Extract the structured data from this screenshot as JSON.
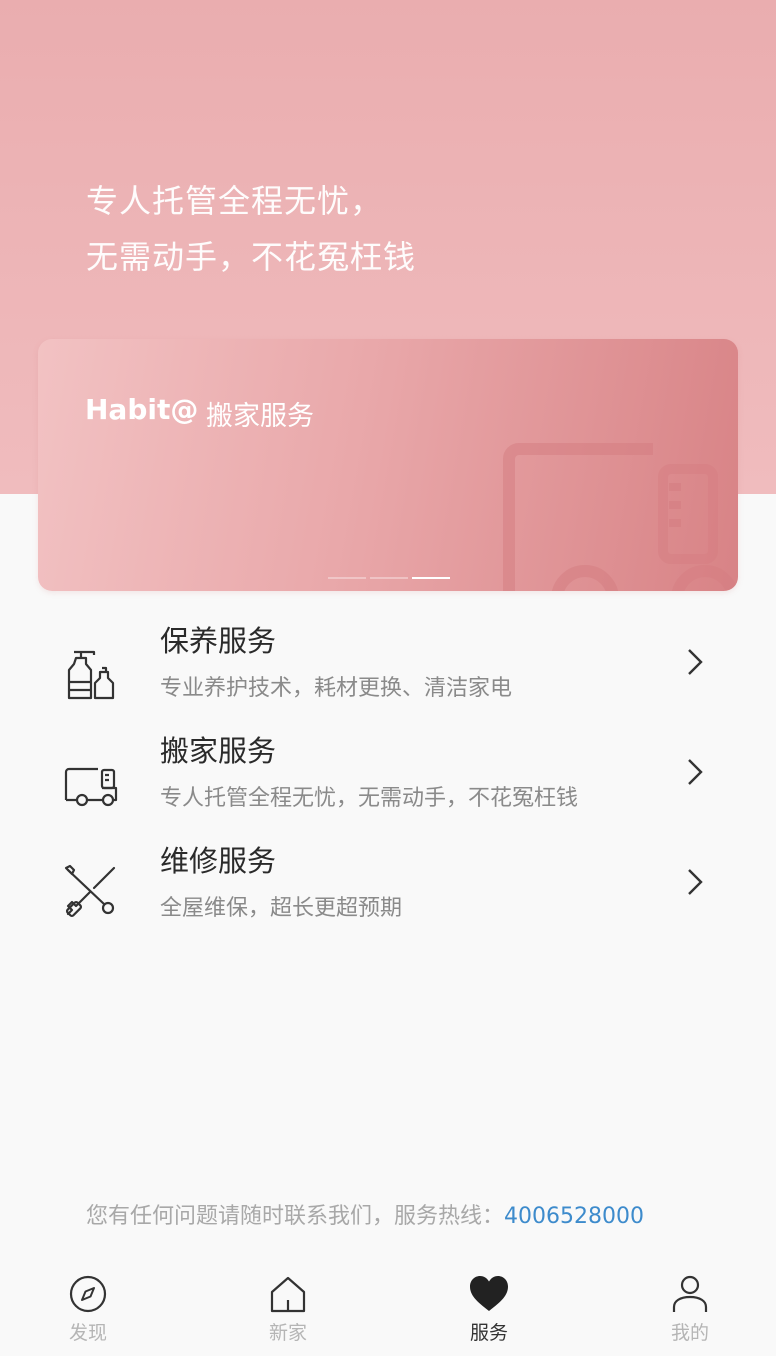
{
  "hero": {
    "line1": "专人托管全程无忧，",
    "line2": "无需动手，不花冤枉钱"
  },
  "banner": {
    "logo": "Habit@",
    "title": "搬家服务",
    "active_dot": 3,
    "dot_count": 3
  },
  "services": [
    {
      "title": "保养服务",
      "desc": "专业养护技术，耗材更换、清洁家电",
      "icon": "bottles-icon"
    },
    {
      "title": "搬家服务",
      "desc": "专人托管全程无忧，无需动手，不花冤枉钱",
      "icon": "truck-icon"
    },
    {
      "title": "维修服务",
      "desc": "全屋维保，超长更超预期",
      "icon": "tools-icon"
    }
  ],
  "hotline": {
    "text": "您有任何问题请随时联系我们，服务热线：",
    "number": "4006528000"
  },
  "tabs": [
    {
      "label": "发现",
      "icon": "compass-icon"
    },
    {
      "label": "新家",
      "icon": "home-icon"
    },
    {
      "label": "服务",
      "icon": "heart-icon",
      "active": true
    },
    {
      "label": "我的",
      "icon": "user-icon"
    }
  ],
  "colors": {
    "hero_bg": "#eaadaf",
    "accent_link": "#3d8bcc",
    "tab_active": "#333333",
    "tab_inactive": "#b5b5b5"
  }
}
